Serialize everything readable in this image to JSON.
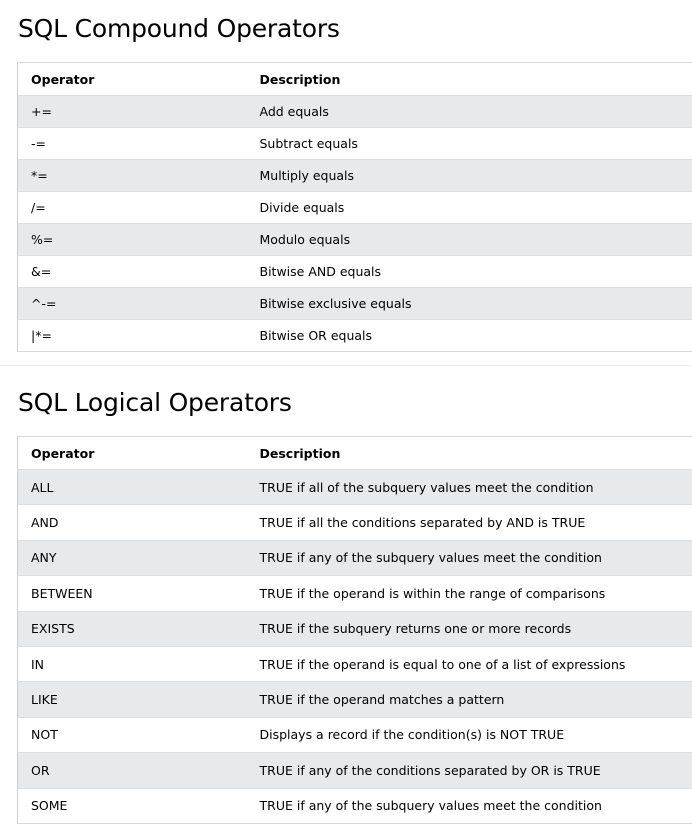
{
  "compound": {
    "title": "SQL Compound Operators",
    "headers": {
      "operator": "Operator",
      "description": "Description"
    },
    "rows": [
      {
        "operator": "+=",
        "description": "Add equals"
      },
      {
        "operator": "-=",
        "description": "Subtract equals"
      },
      {
        "operator": "*=",
        "description": "Multiply equals"
      },
      {
        "operator": "/=",
        "description": "Divide equals"
      },
      {
        "operator": "%=",
        "description": "Modulo equals"
      },
      {
        "operator": "&=",
        "description": "Bitwise AND equals"
      },
      {
        "operator": "^-=",
        "description": "Bitwise exclusive equals"
      },
      {
        "operator": "|*=",
        "description": "Bitwise OR equals"
      }
    ]
  },
  "logical": {
    "title": "SQL Logical Operators",
    "headers": {
      "operator": "Operator",
      "description": "Description"
    },
    "rows": [
      {
        "operator": "ALL",
        "description": "TRUE if all of the subquery values meet the condition"
      },
      {
        "operator": "AND",
        "description": "TRUE if all the conditions separated by AND is TRUE"
      },
      {
        "operator": "ANY",
        "description": "TRUE if any of the subquery values meet the condition"
      },
      {
        "operator": "BETWEEN",
        "description": "TRUE if the operand is within the range of comparisons"
      },
      {
        "operator": "EXISTS",
        "description": "TRUE if the subquery returns one or more records"
      },
      {
        "operator": "IN",
        "description": "TRUE if the operand is equal to one of a list of expressions"
      },
      {
        "operator": "LIKE",
        "description": "TRUE if the operand matches a pattern"
      },
      {
        "operator": "NOT",
        "description": "Displays a record if the condition(s) is NOT TRUE"
      },
      {
        "operator": "OR",
        "description": "TRUE if any of the conditions separated by OR is TRUE"
      },
      {
        "operator": "SOME",
        "description": "TRUE if any of the subquery values meet the condition"
      }
    ]
  },
  "colors": {
    "stripe": "#e7e9eb",
    "border": "#cccccc"
  }
}
